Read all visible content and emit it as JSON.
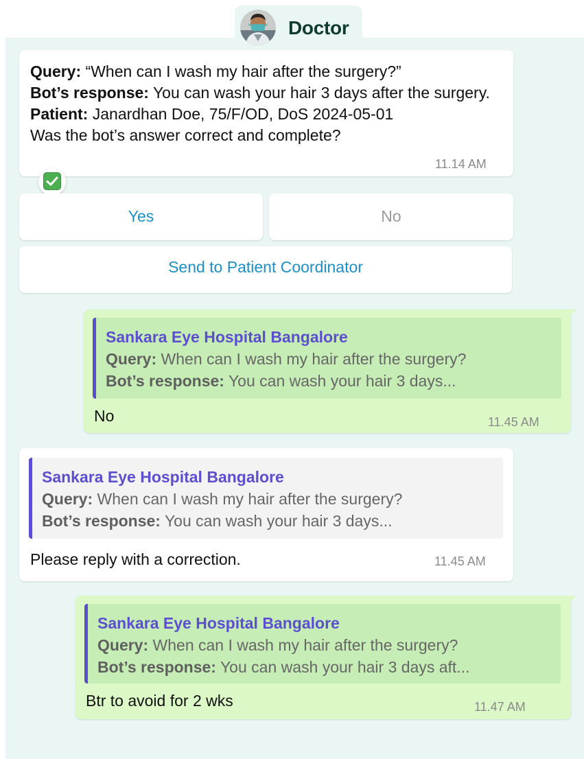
{
  "header": {
    "title": "Doctor"
  },
  "first_message": {
    "query_label": "Query:",
    "query_text": " “When can I wash my hair after the surgery?”",
    "response_label": "Bot’s response:",
    "response_text": " You can wash your hair 3 days after the surgery.",
    "patient_label": "Patient:",
    "patient_text": " Janardhan Doe, 75/F/OD, DoS 2024-05-01",
    "question": "Was the bot’s answer correct and complete?",
    "time": "11.14 AM",
    "reaction": "check-mark"
  },
  "buttons": {
    "yes": "Yes",
    "no": "No",
    "coordinator": "Send to Patient Coordinator"
  },
  "messages": [
    {
      "direction": "outgoing",
      "quote_title": "Sankara Eye Hospital Bangalore",
      "quote_query_label": "Query:",
      "quote_query": " When can I wash my hair after the surgery?",
      "quote_response_label": "Bot’s response:",
      "quote_response": " You can wash your hair 3 days...",
      "text": "No",
      "time": "11.45 AM"
    },
    {
      "direction": "incoming",
      "quote_title": "Sankara Eye Hospital Bangalore",
      "quote_query_label": "Query:",
      "quote_query": " When can I wash my hair after the surgery?",
      "quote_response_label": "Bot’s response:",
      "quote_response": " You can wash your hair 3 days...",
      "text": "Please reply with a correction.",
      "time": "11.45 AM"
    },
    {
      "direction": "outgoing",
      "quote_title": "Sankara Eye Hospital Bangalore",
      "quote_query_label": "Query:",
      "quote_query": " When can I wash my hair after the surgery?",
      "quote_response_label": "Bot’s response:",
      "quote_response": " You can wash your hair 3 days aft...",
      "text": "Btr to avoid for 2 wks",
      "time": "11.47 AM"
    }
  ],
  "colors": {
    "chat_background": "#e9f6f3",
    "outgoing_bubble": "#dcf8c6",
    "quote_accent": "#5b4fd0",
    "button_text": "#1d8fc9",
    "header_text": "#0f3c2e"
  }
}
